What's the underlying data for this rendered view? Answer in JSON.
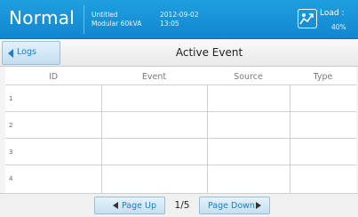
{
  "header": {
    "mode": "Normal",
    "device_name": "Untitled",
    "device_model": "Modular 60kVA",
    "date": "2012-09-02",
    "time": "13:05",
    "load_label": "Load :",
    "load_value": "40%",
    "load_icon": "load-gauge-icon"
  },
  "titlebar": {
    "back_label": "Logs",
    "title": "Active Event"
  },
  "table": {
    "columns": [
      "ID",
      "Event",
      "Source",
      "Type"
    ],
    "rows": [
      {
        "id": "1",
        "event": "",
        "source": "",
        "type": ""
      },
      {
        "id": "2",
        "event": "",
        "source": "",
        "type": ""
      },
      {
        "id": "3",
        "event": "",
        "source": "",
        "type": ""
      },
      {
        "id": "4",
        "event": "",
        "source": "",
        "type": ""
      }
    ]
  },
  "pagination": {
    "page_up_label": "Page Up",
    "page_down_label": "Page Down",
    "page_indicator": "1/5"
  },
  "colors": {
    "header_bg": "#1b95da",
    "accent_text": "#1a7fc4"
  }
}
